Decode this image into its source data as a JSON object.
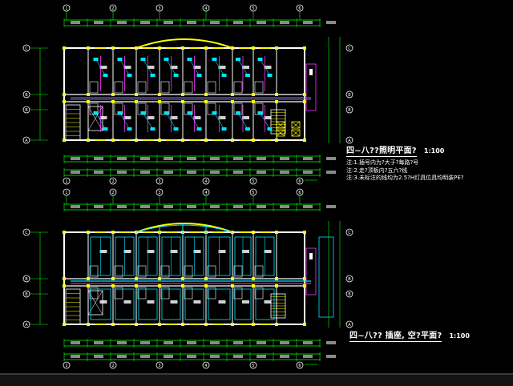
{
  "plans": [
    {
      "title": "四~八??照明平面?",
      "scale": "1:100",
      "notes": [
        "注:1.插号内为?大于?每路?号",
        "注:2.走?顶板内?五六?线",
        "注:3.未标注的线均为2.5?H灯具位具均明装PE?"
      ]
    },
    {
      "title": "四~八?? 插座, 空?平面?",
      "scale": "1:100"
    }
  ],
  "grid_axes": {
    "columns": [
      "1",
      "2",
      "3",
      "4",
      "5",
      "6",
      "7",
      "8",
      "9",
      "10"
    ],
    "rows": [
      "A",
      "B",
      "C",
      "D"
    ]
  },
  "colors": {
    "background": "#000000",
    "wall": "#ffffff",
    "column": "#ffff00",
    "dimension": "#00ff00",
    "circuit_light": "#00e5ff",
    "circuit_power": "#ff33ff",
    "text": "#ffffff"
  }
}
